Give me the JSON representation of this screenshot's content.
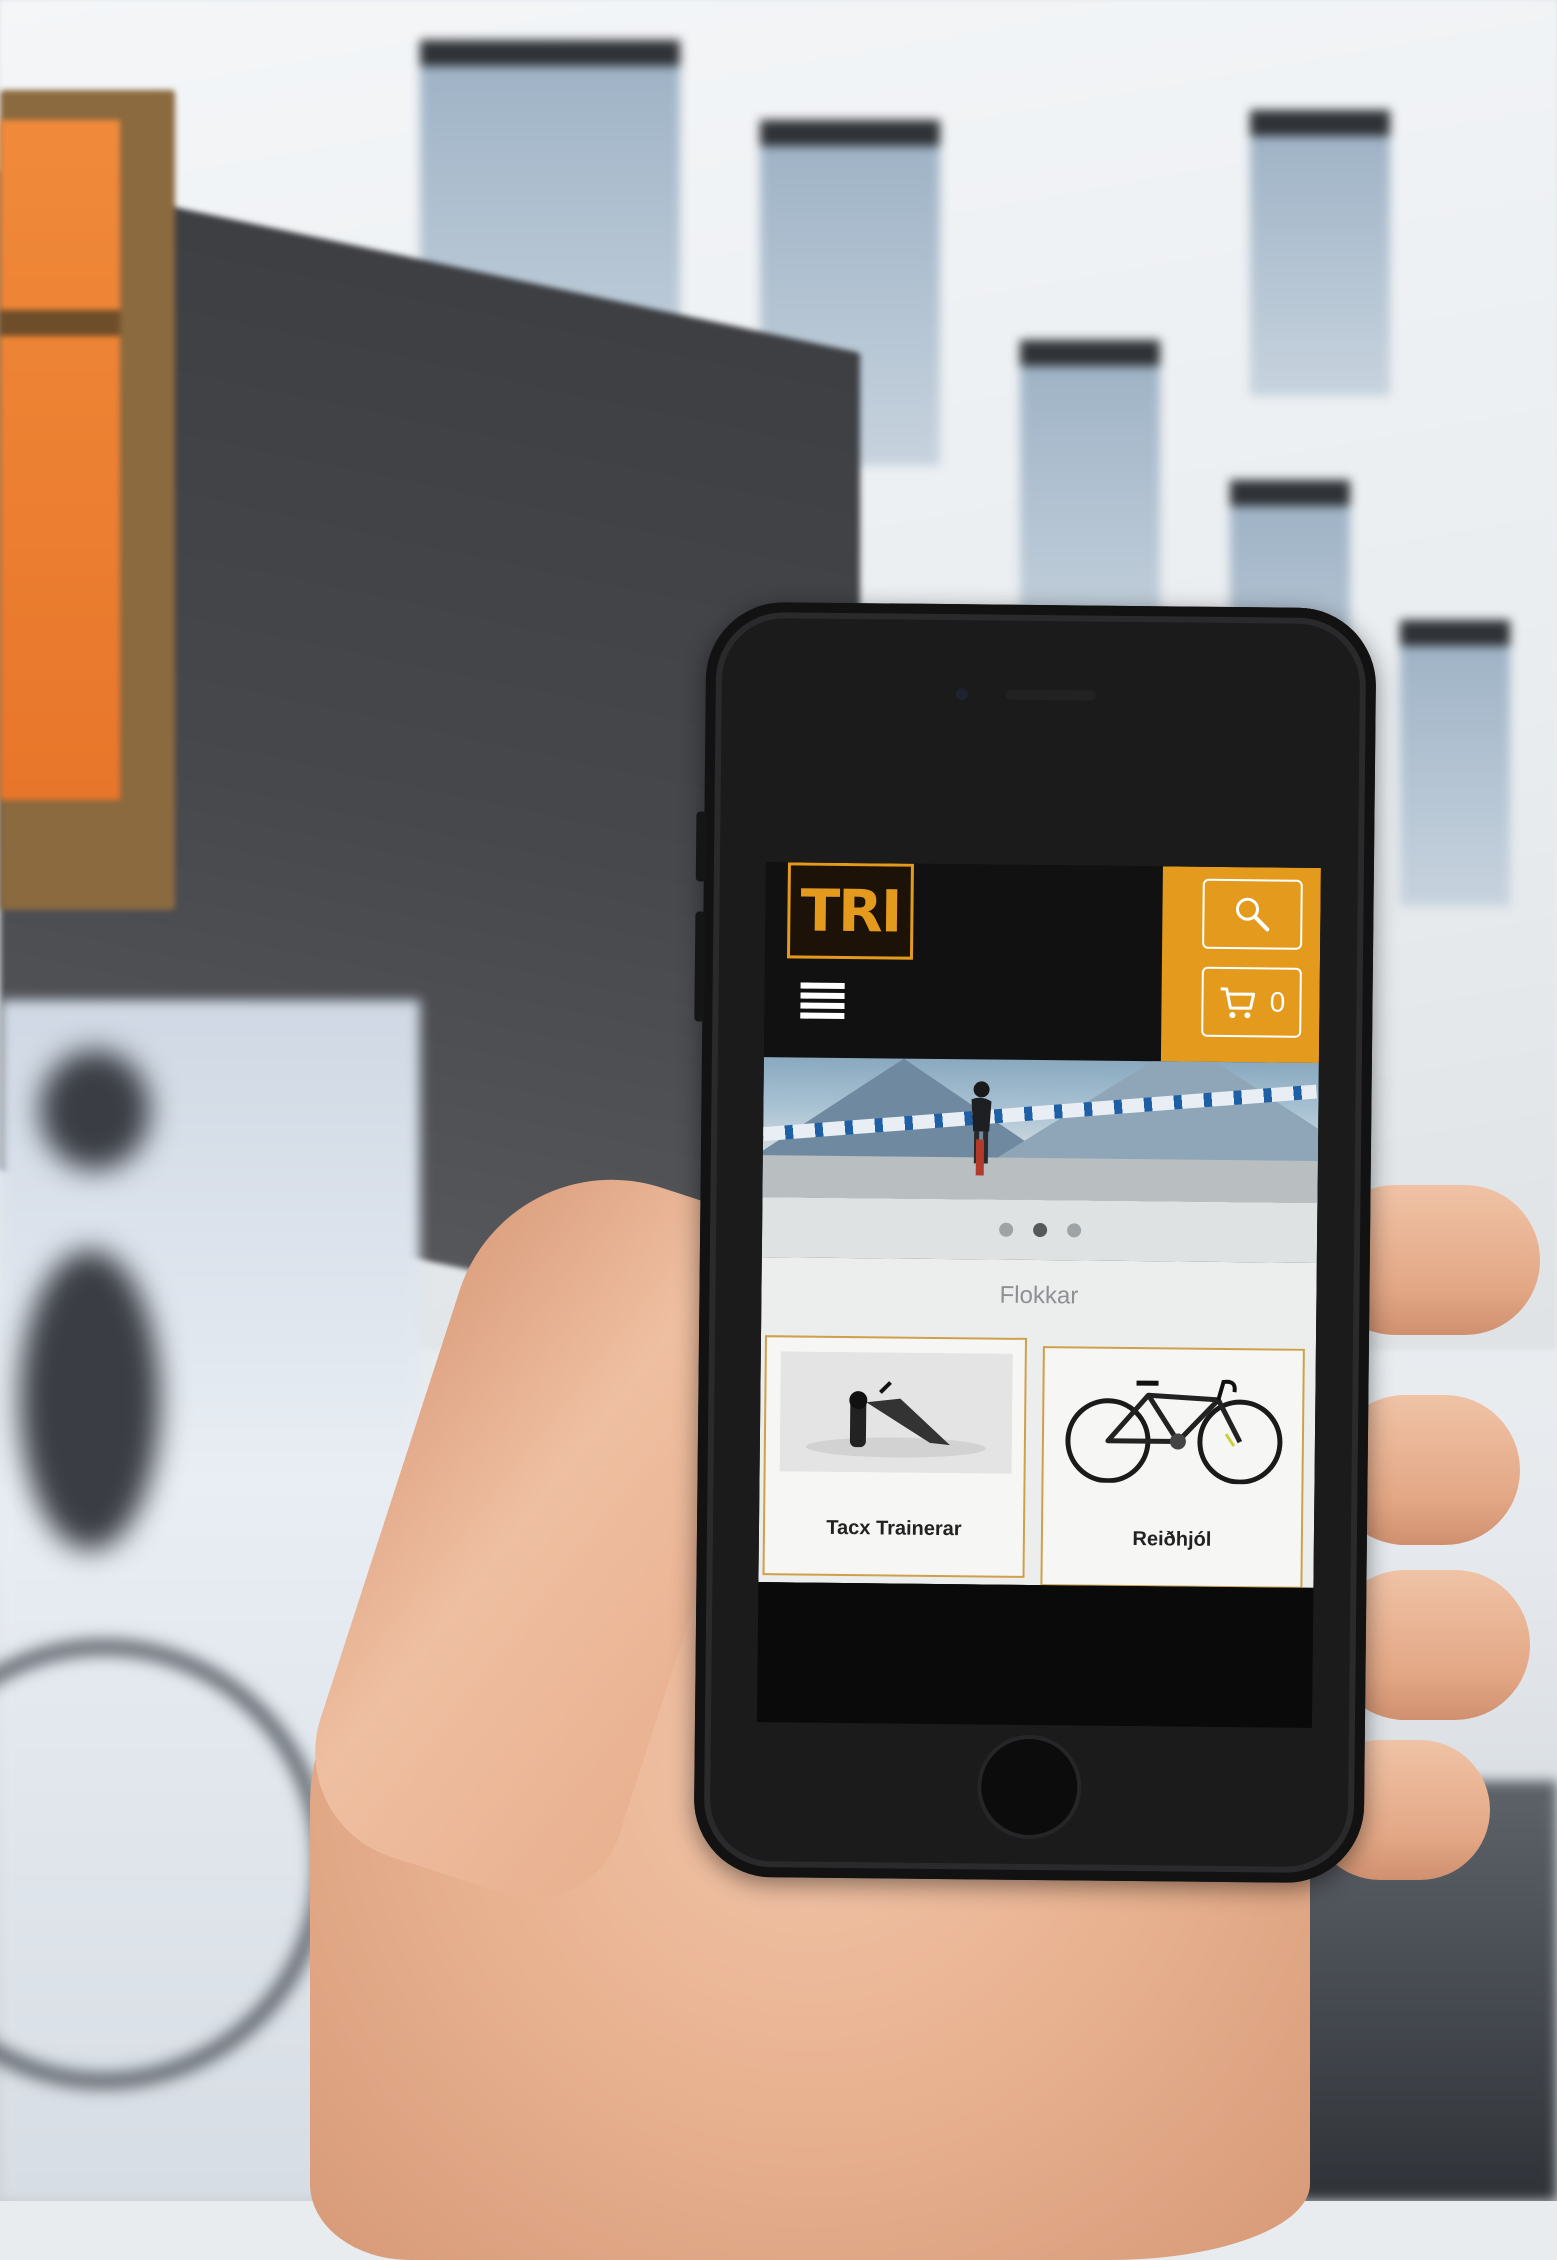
{
  "app": {
    "logo_text": "TRI",
    "cart_count": "0"
  },
  "slider": {
    "slide_count": 3,
    "active_index": 1
  },
  "categories": {
    "heading": "Flokkar",
    "items": [
      {
        "label": "Tacx Trainerar",
        "image": "trainer-image"
      },
      {
        "label": "Reiðhjól",
        "image": "road-bike-image"
      }
    ]
  },
  "icons": {
    "search": "search-icon",
    "cart": "cart-icon",
    "menu": "menu-icon"
  },
  "colors": {
    "brand_orange": "#e39a1d",
    "header_black": "#111111",
    "card_border": "#cfa04a"
  }
}
